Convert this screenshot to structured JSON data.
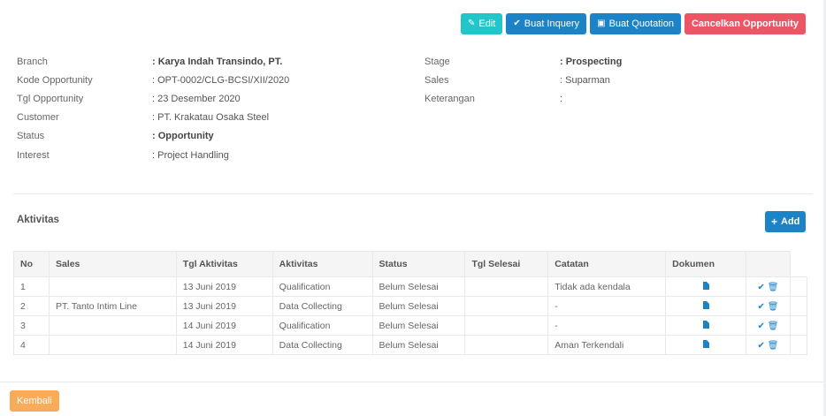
{
  "toolbar": {
    "edit_label": "Edit",
    "buat_inquery_label": "Buat Inquery",
    "buat_quotation_label": "Buat Quotation",
    "cancel_label": "Cancelkan Opportunity"
  },
  "info_left": [
    {
      "label": "Branch",
      "value": ": Karya Indah Transindo, PT.",
      "bold": true
    },
    {
      "label": "Kode Opportunity",
      "value": ": OPT-0002/CLG-BCSI/XII/2020",
      "bold": false
    },
    {
      "label": "Tgl Opportunity",
      "value": ": 23 Desember 2020",
      "bold": false
    },
    {
      "label": "Customer",
      "value": ": PT. Krakatau Osaka Steel",
      "bold": false
    },
    {
      "label": "Status",
      "value": ": Opportunity",
      "bold": true
    },
    {
      "label": "Interest",
      "value": ": Project Handling",
      "bold": false
    }
  ],
  "info_right": [
    {
      "label": "Stage",
      "value": ": Prospecting",
      "bold": true
    },
    {
      "label": "Sales",
      "value": ": Suparman",
      "bold": false
    },
    {
      "label": "Keterangan",
      "value": ":",
      "bold": false
    }
  ],
  "aktivitas": {
    "title": "Aktivitas",
    "add_label": "Add",
    "columns": [
      "No",
      "Sales",
      "Tgl Aktivitas",
      "Aktivitas",
      "Status",
      "Tgl Selesai",
      "Catatan",
      "Dokumen"
    ],
    "rows": [
      {
        "no": "1",
        "sales": "",
        "tgl": "13 Juni 2019",
        "aktivitas": "Qualification",
        "status": "Belum Selesai",
        "selesai": "",
        "catatan": "Tidak ada kendala"
      },
      {
        "no": "2",
        "sales": "PT. Tanto Intim Line",
        "tgl": "13 Juni 2019",
        "aktivitas": "Data Collecting",
        "status": "Belum Selesai",
        "selesai": "",
        "catatan": "-"
      },
      {
        "no": "3",
        "sales": "",
        "tgl": "14 Juni 2019",
        "aktivitas": "Qualification",
        "status": "Belum Selesai",
        "selesai": "",
        "catatan": "-"
      },
      {
        "no": "4",
        "sales": "",
        "tgl": "14 Juni 2019",
        "aktivitas": "Data Collecting",
        "status": "Belum Selesai",
        "selesai": "",
        "catatan": "Aman Terkendali"
      }
    ]
  },
  "footer": {
    "back_label": "Kembali"
  },
  "colors": {
    "teal": "#23c6c8",
    "blue": "#1c84c6",
    "red": "#ed5565",
    "orange": "#f8ac59"
  },
  "icons": {
    "edit": "edit-icon",
    "check": "check-icon",
    "briefcase": "briefcase-icon",
    "plus": "plus-icon",
    "document": "document-icon",
    "trash": "trash-icon"
  }
}
